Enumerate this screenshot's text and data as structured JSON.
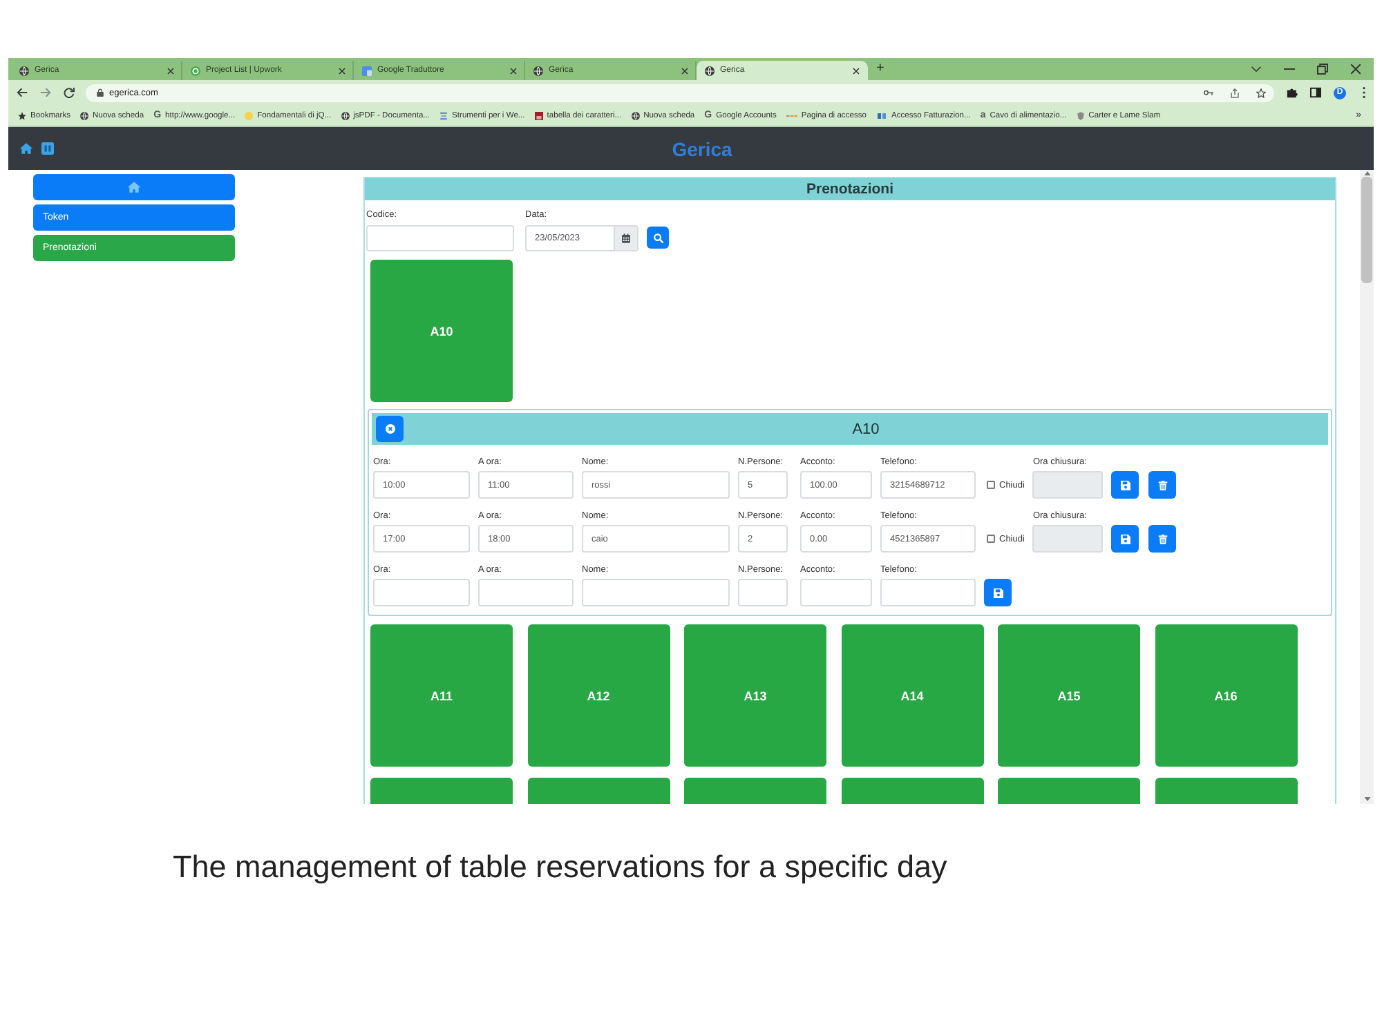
{
  "browser": {
    "tabs": [
      {
        "kind": "globe",
        "title": "Gerica",
        "selected": false
      },
      {
        "kind": "ring",
        "title": "Project List | Upwork",
        "selected": false
      },
      {
        "kind": "tiles",
        "title": "Google Traduttore",
        "selected": false
      },
      {
        "kind": "globe",
        "title": "Gerica",
        "selected": false
      },
      {
        "kind": "globe",
        "title": "Gerica",
        "selected": true
      }
    ],
    "new_tab": "+",
    "address": "egerica.com",
    "profile": "D",
    "bookmarks": [
      {
        "kind": "star",
        "label": "Bookmarks"
      },
      {
        "kind": "globe",
        "label": "Nuova scheda"
      },
      {
        "kind": "letter",
        "glyph": "G",
        "label": "http://www.google..."
      },
      {
        "kind": "blob",
        "label": "Fondamentali di jQ..."
      },
      {
        "kind": "globe",
        "label": "jsPDF - Documenta..."
      },
      {
        "kind": "bars",
        "label": "Strumenti per i We..."
      },
      {
        "kind": "picture",
        "label": "tabella dei caratteri..."
      },
      {
        "kind": "globe",
        "label": "Nuova scheda"
      },
      {
        "kind": "letter",
        "glyph": "G",
        "label": "Google Accounts"
      },
      {
        "kind": "dashes",
        "label": "Pagina di accesso"
      },
      {
        "kind": "squares",
        "label": "Accesso Fatturazion..."
      },
      {
        "kind": "letter",
        "glyph": "a",
        "label": "Cavo di alimentazio..."
      },
      {
        "kind": "shield",
        "label": "Carter e Lame Slam"
      }
    ],
    "bookmarks_more": "»"
  },
  "app": {
    "navbar": {
      "brand": "Gerica"
    },
    "sidebar": {
      "items": [
        {
          "kind": "icon",
          "selected": false
        },
        {
          "kind": "text",
          "label": "Token",
          "selected": false
        },
        {
          "kind": "text",
          "label": "Prenotazioni",
          "selected": true
        }
      ]
    },
    "panel": {
      "title": "Prenotazioni",
      "filters": [
        {
          "kind": "text",
          "label": "Codice:"
        },
        {
          "kind": "date",
          "label": "Data:",
          "value": "23/05/2023"
        }
      ],
      "results": [
        {
          "label": "A10"
        }
      ],
      "detail": {
        "title": "A10",
        "rows": [
          {
            "kind": "saved",
            "fields": [
              {
                "label": "Ora:",
                "value": "10:00"
              },
              {
                "label": "A ora:",
                "value": "11:00"
              },
              {
                "label": "Nome:",
                "value": "rossi"
              },
              {
                "label": "N.Persone:",
                "value": "5"
              },
              {
                "label": "Acconto:",
                "value": "100.00"
              },
              {
                "label": "Telefono:",
                "value": "32154689712"
              }
            ],
            "close": {
              "label": "Chiudi",
              "checked": false
            },
            "closing_time": {
              "label": "Ora chiusura:",
              "disabled": true
            }
          },
          {
            "kind": "saved",
            "fields": [
              {
                "label": "Ora:",
                "value": "17:00"
              },
              {
                "label": "A ora:",
                "value": "18:00"
              },
              {
                "label": "Nome:",
                "value": "caio"
              },
              {
                "label": "N.Persone:",
                "value": "2"
              },
              {
                "label": "Acconto:",
                "value": "0.00"
              },
              {
                "label": "Telefono:",
                "value": "4521365897"
              }
            ],
            "close": {
              "label": "Chiudi",
              "checked": false
            },
            "closing_time": {
              "label": "Ora chiusura:",
              "disabled": true
            }
          },
          {
            "kind": "new",
            "fields": [
              {
                "label": "Ora:"
              },
              {
                "label": "A ora:"
              },
              {
                "label": "Nome:"
              },
              {
                "label": "N.Persone:"
              },
              {
                "label": "Acconto:"
              },
              {
                "label": "Telefono:"
              }
            ]
          }
        ]
      },
      "tables": [
        {
          "kind": "tile",
          "label": "A11"
        },
        {
          "kind": "tile",
          "label": "A12"
        },
        {
          "kind": "tile",
          "label": "A13"
        },
        {
          "kind": "tile",
          "label": "A14"
        },
        {
          "kind": "tile",
          "label": "A15"
        },
        {
          "kind": "tile",
          "label": "A16"
        },
        {
          "kind": "tile"
        },
        {
          "kind": "tile"
        },
        {
          "kind": "tile"
        },
        {
          "kind": "tile"
        },
        {
          "kind": "tile"
        },
        {
          "kind": "tile"
        }
      ]
    }
  },
  "caption": "The management of table reservations for a specific day"
}
